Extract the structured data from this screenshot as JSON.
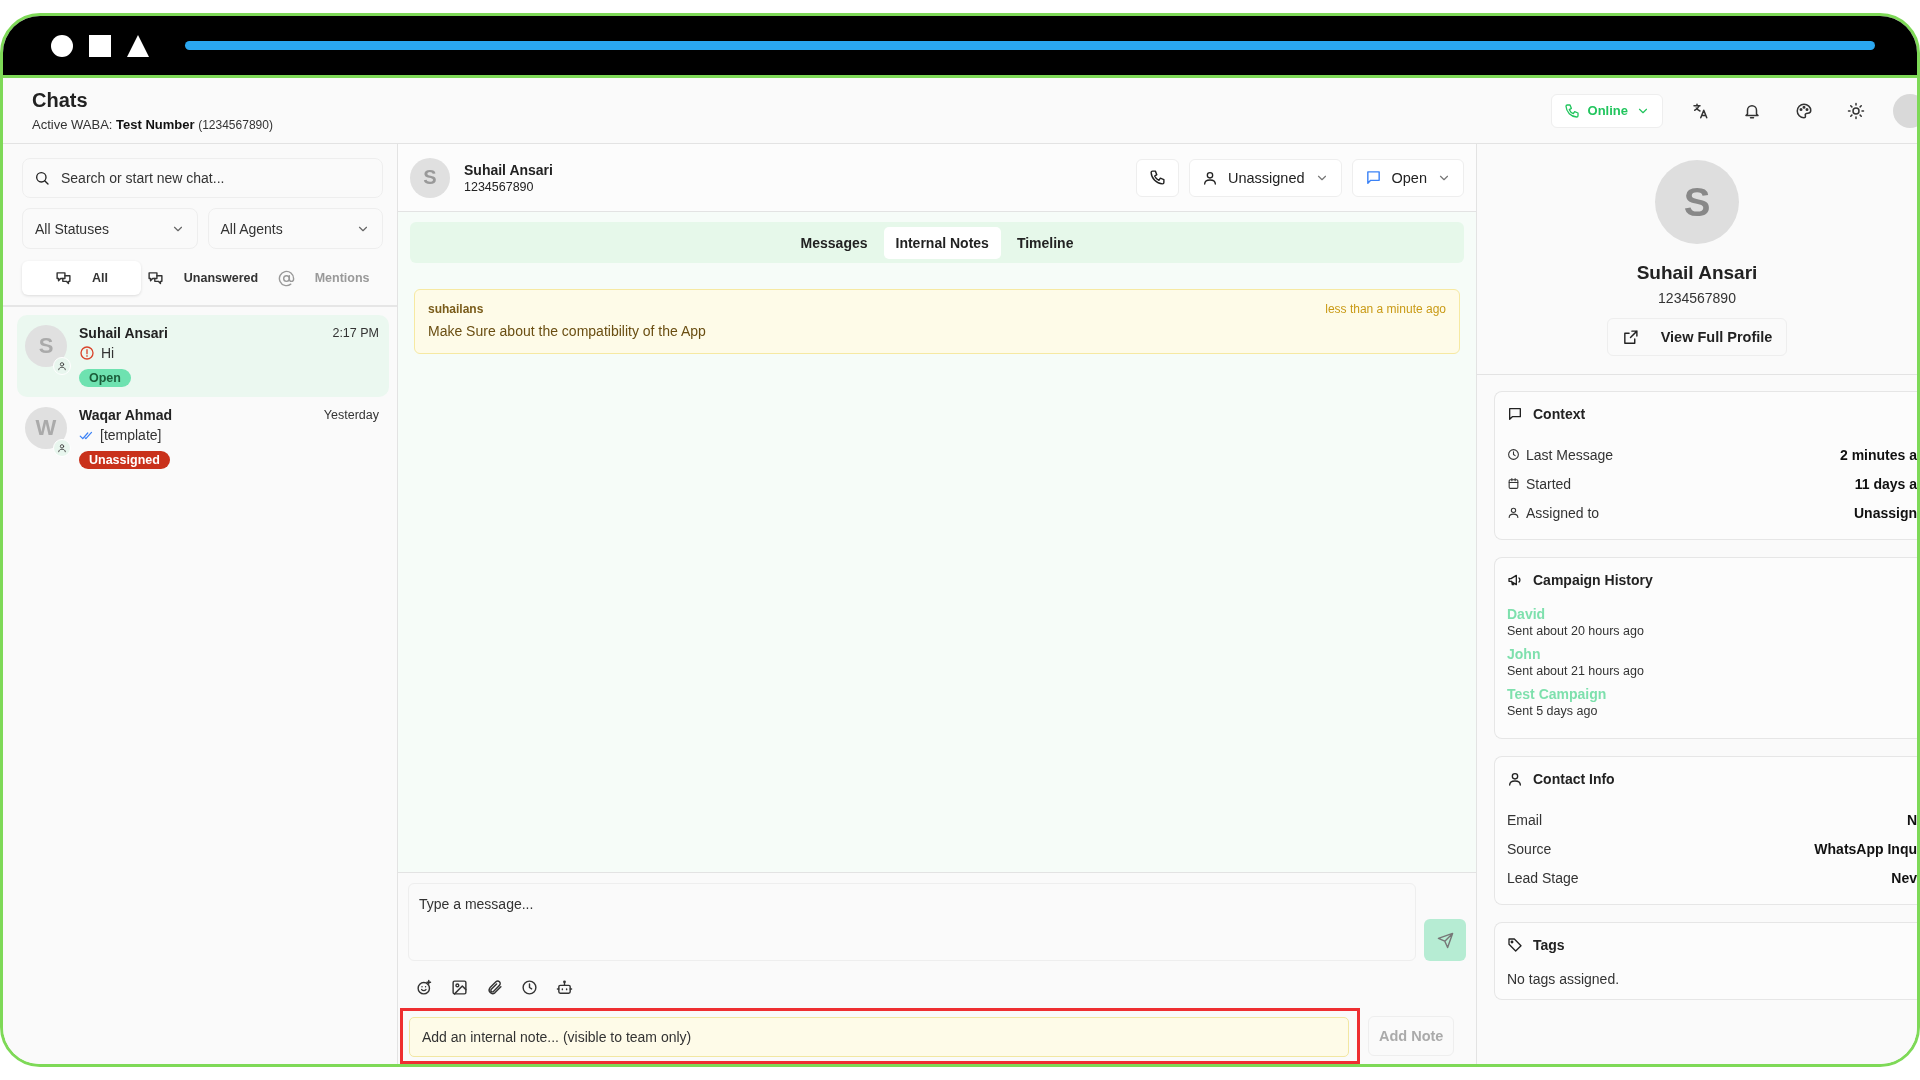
{
  "header": {
    "title": "Chats",
    "waba_label": "Active WABA:",
    "waba_name": "Test Number",
    "waba_number": "(1234567890)",
    "presence": "Online"
  },
  "sidebar": {
    "search": {
      "placeholder": "Search or start new chat..."
    },
    "filters": [
      {
        "label": "All Statuses"
      },
      {
        "label": "All Agents"
      }
    ],
    "tabs": [
      {
        "label": "All",
        "kind": "chats",
        "selected": true,
        "disabled": false
      },
      {
        "label": "Unanswered",
        "kind": "chats",
        "selected": false,
        "disabled": false
      },
      {
        "label": "Mentions",
        "kind": "mention",
        "selected": false,
        "disabled": true
      }
    ],
    "chats": [
      {
        "initial": "S",
        "name": "Suhail Ansari",
        "time": "2:17 PM",
        "preview": "Hi",
        "kind": "failed",
        "badge": "Open",
        "color": "#6ee2b0",
        "selected": true
      },
      {
        "initial": "W",
        "name": "Waqar Ahmad",
        "time": "Yesterday",
        "preview": "[template]",
        "kind": "read",
        "badge": "Unassigned",
        "color": "#c9311b",
        "selected": false
      }
    ]
  },
  "conversation": {
    "initial": "S",
    "name": "Suhail Ansari",
    "number": "1234567890",
    "assignee": "Unassigned",
    "status": "Open",
    "tabs": [
      {
        "label": "Messages",
        "selected": false
      },
      {
        "label": "Internal Notes",
        "selected": true
      },
      {
        "label": "Timeline",
        "selected": false
      }
    ],
    "notes": [
      {
        "author": "suhailans",
        "time": "less than a minute ago",
        "text": "Make Sure about the compatibility of the App"
      }
    ],
    "composer": {
      "placeholder": "Type a message..."
    },
    "note_input": {
      "placeholder": "Add an internal note... (visible to team only)",
      "highlighted": true
    },
    "add_note": {
      "label": "Add Note",
      "disabled": true
    }
  },
  "profile": {
    "initial": "S",
    "name": "Suhail Ansari",
    "number": "1234567890",
    "view_button": "View Full Profile",
    "context": {
      "title": "Context",
      "rows": [
        {
          "kind": "clock",
          "label": "Last Message",
          "value": "2 minutes a"
        },
        {
          "kind": "calendar",
          "label": "Started",
          "value": "11 days a"
        },
        {
          "kind": "person",
          "label": "Assigned to",
          "value": "Unassign"
        }
      ]
    },
    "campaigns": {
      "title": "Campaign History",
      "items": [
        {
          "name": "David",
          "sent": "Sent about 20 hours ago"
        },
        {
          "name": "John",
          "sent": "Sent about 21 hours ago"
        },
        {
          "name": "Test Campaign",
          "sent": "Sent 5 days ago"
        }
      ]
    },
    "contact_info": {
      "title": "Contact Info",
      "rows": [
        {
          "label": "Email",
          "value": "N"
        },
        {
          "label": "Source",
          "value": "WhatsApp Inqu"
        },
        {
          "label": "Lead Stage",
          "value": "Nev"
        }
      ]
    },
    "tags": {
      "title": "Tags",
      "empty": "No tags assigned."
    }
  }
}
